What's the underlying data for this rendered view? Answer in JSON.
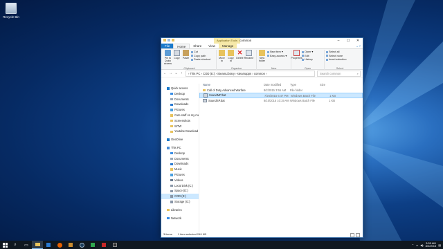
{
  "desktop": {
    "recycle_bin_label": "Recycle Bin"
  },
  "window": {
    "title": "common",
    "context_tab": "Application Tools",
    "controls": [
      "–",
      "☐",
      "✕"
    ]
  },
  "ribbon_tabs": [
    "File",
    "Home",
    "Share",
    "View",
    "Manage"
  ],
  "ribbon": {
    "clipboard": {
      "label": "Clipboard",
      "pin": "Pin to Quick access",
      "copy": "Copy",
      "paste": "Paste",
      "cut": "Cut",
      "copy_path": "Copy path",
      "paste_shortcut": "Paste shortcut"
    },
    "organize": {
      "label": "Organize",
      "move_to": "Move to",
      "copy_to": "Copy to",
      "delete": "Delete",
      "rename": "Rename"
    },
    "new": {
      "label": "New",
      "new_folder": "New folder",
      "new_item": "New item ▾",
      "easy_access": "Easy access ▾"
    },
    "open": {
      "label": "Open",
      "properties": "Properties",
      "open": "Open ▾",
      "edit": "Edit",
      "history": "History"
    },
    "select": {
      "label": "Select",
      "select_all": "Select all",
      "select_none": "Select none",
      "invert": "Invert selection"
    }
  },
  "address": {
    "path": "› This PC  ›  COD (E:)  ›  SteamLibrary  ›  steamapps  ›  common  ›",
    "search_placeholder": "Search common"
  },
  "nav_pane": [
    {
      "label": "Quick access",
      "icon": "star-icon",
      "level": 0
    },
    {
      "label": "Desktop",
      "icon": "desktop-icon",
      "level": 1
    },
    {
      "label": "Documents",
      "icon": "documents-icon",
      "level": 1
    },
    {
      "label": "Downloads",
      "icon": "downloads-icon",
      "level": 1
    },
    {
      "label": "Pictures",
      "icon": "pictures-icon",
      "level": 1
    },
    {
      "label": "Cute stuff vs my mem",
      "icon": "folder-icon",
      "level": 1
    },
    {
      "label": "Screenshots",
      "icon": "folder-icon",
      "level": 1
    },
    {
      "label": "WTW",
      "icon": "folder-icon",
      "level": 1
    },
    {
      "label": "Youtube Download",
      "icon": "folder-icon",
      "level": 1
    },
    {
      "label": "",
      "icon": "",
      "level": -1
    },
    {
      "label": "OneDrive",
      "icon": "cloud-icon",
      "level": 0
    },
    {
      "label": "",
      "icon": "",
      "level": -1
    },
    {
      "label": "This PC",
      "icon": "pc-icon",
      "level": 0
    },
    {
      "label": "Desktop",
      "icon": "desktop-icon",
      "level": 1
    },
    {
      "label": "Documents",
      "icon": "documents-icon",
      "level": 1
    },
    {
      "label": "Downloads",
      "icon": "downloads-icon",
      "level": 1
    },
    {
      "label": "Music",
      "icon": "music-icon",
      "level": 1
    },
    {
      "label": "Pictures",
      "icon": "pictures-icon",
      "level": 1
    },
    {
      "label": "Videos",
      "icon": "videos-icon",
      "level": 1
    },
    {
      "label": "Local Disk (C:)",
      "icon": "drive-icon",
      "level": 1
    },
    {
      "label": "Space (D:)",
      "icon": "drive-icon",
      "level": 1
    },
    {
      "label": "COD (E:)",
      "icon": "drive-icon",
      "level": 1,
      "selected": true
    },
    {
      "label": "Storage (G:)",
      "icon": "drive-icon",
      "level": 1
    },
    {
      "label": "",
      "icon": "",
      "level": -1
    },
    {
      "label": "Libraries",
      "icon": "libraries-icon",
      "level": 0
    },
    {
      "label": "",
      "icon": "",
      "level": -1
    },
    {
      "label": "Network",
      "icon": "network-icon",
      "level": 0
    }
  ],
  "file_columns": [
    "Name",
    "Date modified",
    "Type",
    "Size"
  ],
  "files": [
    {
      "name": "Call of Duty Advanced Warfare",
      "date": "8/2/2015 3:55 AM",
      "type": "File folder",
      "size": "",
      "icon": "folder-icon"
    },
    {
      "name": "SoundMP.bat",
      "date": "7/26/2015 6:47 PM",
      "type": "Windows Batch File",
      "size": "1 KB",
      "icon": "batch-file-icon",
      "selected": true
    },
    {
      "name": "SoundSP.bat",
      "date": "8/10/2015 10:19 AM",
      "type": "Windows Batch File",
      "size": "1 KB",
      "icon": "batch-file-icon"
    }
  ],
  "status": {
    "items": "3 items",
    "selected": "1 item selected  249 KB"
  },
  "clock": {
    "time": "3:55 AM",
    "date": "8/2/2015"
  },
  "colors": {
    "accent": "#1979ca",
    "selection": "#cce8ff",
    "folder": "#e8c35d"
  }
}
